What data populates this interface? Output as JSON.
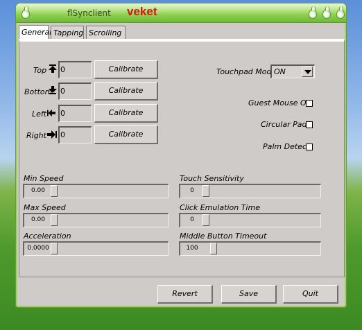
{
  "window": {
    "app_title": "flSynclient",
    "brand": "veket"
  },
  "tabs": [
    {
      "label": "General",
      "active": true
    },
    {
      "label": "Tapping",
      "active": false
    },
    {
      "label": "Scrolling",
      "active": false
    }
  ],
  "edges": [
    {
      "label": "Top",
      "icon": "arrow-up-to-line-icon",
      "value": "0",
      "button": "Calibrate"
    },
    {
      "label": "Bottom",
      "icon": "arrow-down-to-line-icon",
      "value": "0",
      "button": "Calibrate"
    },
    {
      "label": "Left",
      "icon": "arrow-left-to-line-icon",
      "value": "0",
      "button": "Calibrate"
    },
    {
      "label": "Right",
      "icon": "arrow-right-to-line-icon",
      "value": "0",
      "button": "Calibrate"
    }
  ],
  "touchpad_mode": {
    "label": "Touchpad Mode",
    "value": "ON"
  },
  "checkboxes": [
    {
      "label": "Guest Mouse Off",
      "checked": false
    },
    {
      "label": "Circular Pad",
      "checked": false
    },
    {
      "label": "Palm Detect",
      "checked": false
    }
  ],
  "sliders_left": [
    {
      "label": "Min Speed",
      "value": "0.00",
      "level": 0
    },
    {
      "label": "Max Speed",
      "value": "0.00",
      "level": 0
    },
    {
      "label": "Acceleration",
      "value": "0.0000",
      "level": 0
    }
  ],
  "sliders_right": [
    {
      "label": "Touch Sensitivity",
      "value": "0",
      "level": 0
    },
    {
      "label": "Click Emulation Time",
      "value": "0",
      "level": 0
    },
    {
      "label": "Middle Button Timeout",
      "value": "100",
      "level": 0.07
    }
  ],
  "footer": {
    "revert": "Revert",
    "save": "Save",
    "quit": "Quit"
  },
  "colors": {
    "titlebar": "#8fd04e",
    "brand": "#cc1a10",
    "window_bg": "#cfcbc8"
  }
}
